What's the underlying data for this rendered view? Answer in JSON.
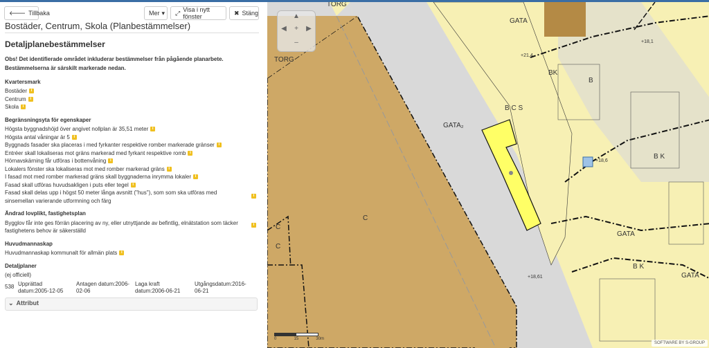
{
  "toolbar": {
    "back_label": "Tillbaka",
    "more_label": "Mer",
    "new_window_label": "Visa i nytt fönster",
    "close_label": "Stäng"
  },
  "page_title": "Bostäder, Centrum, Skola (Planbestämmelser)",
  "section_title": "Detaljplanebestämmelser",
  "notice": "Obs! Det identifierade området inkluderar bestämmelser från pågående planarbete. Bestämmelserna är särskilt markerade nedan.",
  "kvartersmark": {
    "heading": "Kvartersmark",
    "items": [
      "Bostäder",
      "Centrum",
      "Skola"
    ]
  },
  "begransning": {
    "heading": "Begränsningsyta för egenskaper",
    "items": [
      "Högsta byggnadshöjd över angivet nollplan är 35,51 meter",
      "Högsta antal våningar är 5",
      "Byggnads fasader ska placeras i med fyrkanter respektive romber markerade gränser",
      "Entréer skall lokaliseras mot gräns markerad med fyrkant respektive romb",
      "Hörnavskärning får utföras i bottenvåning",
      "Lokalers fönster ska lokaliseras mot med romber markerad gräns",
      "I fasad mot med romber markerad gräns skall byggnaderna inrymma lokaler",
      "Fasad skall utföras huvudsakligen i puts eller tegel",
      "Fasad skall delas upp i högst 50 meter långa avsnitt (\"hus\"), som som ska utföras med sinsemellan varierande utformning och färg"
    ]
  },
  "lovplikt": {
    "heading": "Ändrad lovplikt, fastighetsplan",
    "items": [
      "Bygglov får inte ges förrän placering av ny, eller utnyttjande av befintlig, elnätstation som täcker fastighetens behov är säkerställd"
    ]
  },
  "huvudmannaskap": {
    "heading": "Huvudmannaskap",
    "items": [
      "Huvudmannaskap kommunalt för allmän plats"
    ]
  },
  "detaljplaner": {
    "heading": "Detaljplaner",
    "status": "(ej officiell)",
    "number": "538",
    "upprattad": "Upprättad datum:2005-12-05",
    "antagen": "Antagen datum:2006-02-06",
    "laga_kraft": "Laga kraft datum:2006-06-21",
    "utgang": "Utgångsdatum:2016-06-21"
  },
  "attribut_label": "Attribut",
  "map": {
    "labels": {
      "torg1": "TORG",
      "torg2": "TORG",
      "gata1": "GATA",
      "gata2": "GATA₂",
      "gata3": "GATA",
      "gata4": "GATA",
      "bcs": "B C S",
      "c1": "C",
      "c2": "C",
      "c3": "C",
      "b": "B",
      "bk1": "BK",
      "bk2": "B K",
      "bk3": "B K",
      "h1": "+21,4",
      "h2": "+18,1",
      "h3": "+18,6",
      "h4": "+18,61"
    },
    "scale_labels": [
      "0",
      "15",
      "30m"
    ],
    "logo": "SOFTWARE BY S-GROUP"
  }
}
